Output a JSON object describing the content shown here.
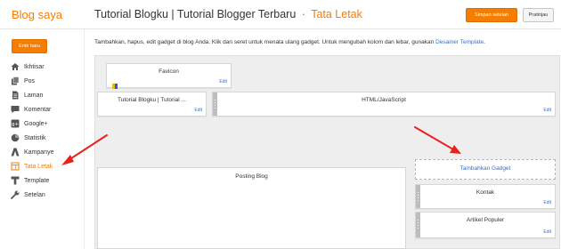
{
  "header": {
    "logo": "Blog saya",
    "blog_title": "Tutorial Blogku | Tutorial Blogger Terbaru",
    "separator": "·",
    "page_title": "Tata Letak",
    "save_label": "Simpan setelan",
    "preview_label": "Pratinjau",
    "accent_color": "#f57d00"
  },
  "sidebar": {
    "new_post_label": "Entri baru",
    "items": [
      {
        "label": "Ikhtisar",
        "icon": "home-icon"
      },
      {
        "label": "Pos",
        "icon": "posts-icon"
      },
      {
        "label": "Laman",
        "icon": "pages-icon"
      },
      {
        "label": "Komentar",
        "icon": "comment-icon"
      },
      {
        "label": "Google+",
        "icon": "google-plus-icon"
      },
      {
        "label": "Statistik",
        "icon": "stats-icon"
      },
      {
        "label": "Kampanye",
        "icon": "campaign-icon"
      },
      {
        "label": "Tata Letak",
        "icon": "layout-icon",
        "active": true
      },
      {
        "label": "Template",
        "icon": "template-icon"
      },
      {
        "label": "Setelan",
        "icon": "wrench-icon"
      }
    ]
  },
  "main": {
    "intro_text": "Tambahkan, hapus, edit gadget di blog Anda. Klik dan seret untuk menata ulang gadget. Untuk mengubah kolom dan lebar, gunakan",
    "intro_link": "Desainer Template",
    "intro_end": ".",
    "gadgets": {
      "favicon": {
        "title": "Favicon",
        "edit": "Edit"
      },
      "header": {
        "title": "Tutorial Blogku | Tutorial ...",
        "edit": "Edit"
      },
      "html_js": {
        "title": "HTML/JavaScript",
        "edit": "Edit"
      },
      "posting": {
        "title": "Posting Blog"
      },
      "add_gadget": {
        "title": "Tambahkan Gadget"
      },
      "kontak": {
        "title": "Kontak",
        "edit": "Edit"
      },
      "artikel": {
        "title": "Artikel Populer",
        "edit": "Edit"
      }
    },
    "arrow_color": "#e8231d"
  }
}
